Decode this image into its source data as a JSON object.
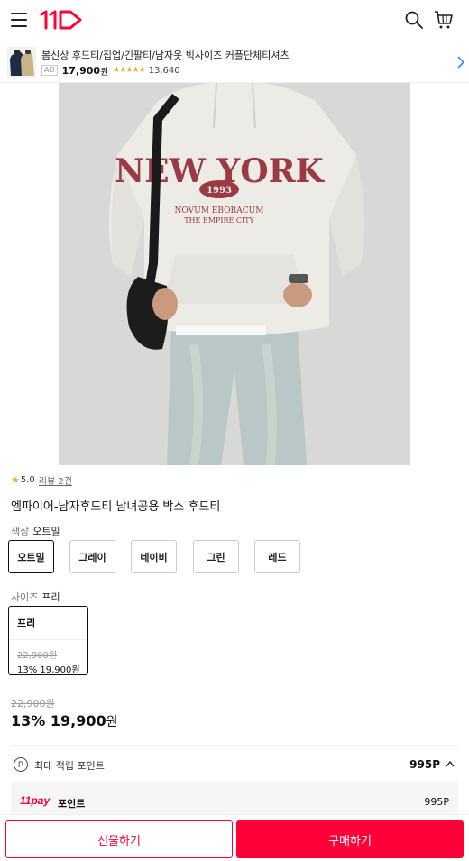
{
  "header": {
    "logo_text": "11",
    "menu_icon": "hamburger-menu-icon",
    "search_icon": "search-icon",
    "cart_icon": "cart-icon"
  },
  "ad": {
    "title": "봄신상 후드티/집업/긴팔티/남자옷 빅사이즈 커플단체티셔츠",
    "badge": "AD",
    "price": "17,900",
    "won": "원",
    "stars": "★★★★★",
    "rating_value": 4.5,
    "review_count": "13,640"
  },
  "product": {
    "image_alt": "NEW YORK",
    "rating": "5.0",
    "review_link": "리뷰 2건",
    "title": "엠파이어-남자후드티 남녀공용 박스 후드티",
    "color_label": "색상",
    "color_selected": "오트밀",
    "colors": [
      "오트밀",
      "그레이",
      "네이비",
      "그린",
      "레드"
    ],
    "size_label": "사이즈",
    "size_selected": "프리",
    "size_card": {
      "name": "프리",
      "original": "22,900원",
      "discounted": "13% 19,900원"
    },
    "original_price": "22,900원",
    "discount_percent": "13%",
    "final_price": "19,900",
    "won": "원"
  },
  "points": {
    "icon_letter": "P",
    "label": "최대 적립 포인트",
    "value": "995P",
    "pay_logo": "11pay",
    "pay_label": "포인트",
    "pay_value": "995P"
  },
  "actions": {
    "gift": "선물하기",
    "buy": "구매하기"
  },
  "colors": {
    "brand": "#ff0038",
    "star": "#f5a623"
  }
}
